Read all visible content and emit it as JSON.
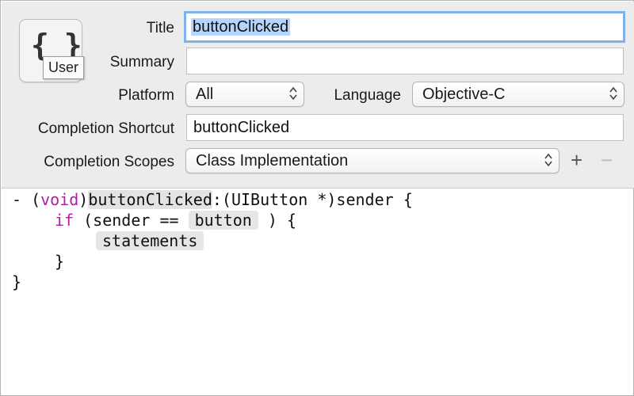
{
  "icon": {
    "name": "braces-icon",
    "glyph": "{ }",
    "tooltip": "User"
  },
  "form": {
    "title": {
      "label": "Title",
      "value": "buttonClicked"
    },
    "summary": {
      "label": "Summary",
      "value": ""
    },
    "platform": {
      "label": "Platform",
      "value": "All"
    },
    "language": {
      "label": "Language",
      "value": "Objective-C"
    },
    "shortcut": {
      "label": "Completion Shortcut",
      "value": "buttonClicked"
    },
    "scopes": {
      "label": "Completion Scopes",
      "value": "Class Implementation",
      "add": "+",
      "remove": "−"
    }
  },
  "code": {
    "l1_dash": "- (",
    "l1_void": "void",
    "l1_close": ")",
    "l1_name": "buttonClicked",
    "l1_rest": ":(UIButton *)sender {",
    "l2_if": "if",
    "l2_mid": " (sender == ",
    "l2_ph": "button",
    "l2_end": " ) {",
    "l3_ph": "statements",
    "l4": "}",
    "l5": "}"
  },
  "colors": {
    "keyword": "#b01f9b",
    "focus_ring": "#7fb2e8",
    "selection": "#b6d5fc"
  }
}
